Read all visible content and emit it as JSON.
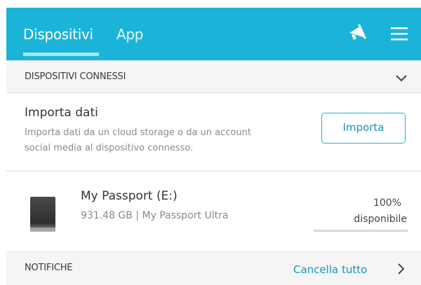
{
  "header": {
    "tabs": [
      {
        "label": "Dispositivi",
        "active": true
      },
      {
        "label": "App",
        "active": false
      }
    ],
    "icons": [
      "megaphone-icon",
      "menu-icon"
    ],
    "color": "#1bb4d8"
  },
  "connected_section": {
    "title": "DISPOSITIVI CONNESSI"
  },
  "import": {
    "title": "Importa dati",
    "description": "Importa dati da un cloud storage o da un account social media al dispositivo connesso.",
    "button_label": "Importa"
  },
  "device": {
    "name": "My Passport (E:)",
    "meta": "931.48 GB | My Passport Ultra",
    "available_percent_label": "100%",
    "available_label": "disponibile",
    "available_fraction": 1.0
  },
  "notifications_section": {
    "title": "NOTIFICHE",
    "clear_label": "Cancella tutto"
  }
}
